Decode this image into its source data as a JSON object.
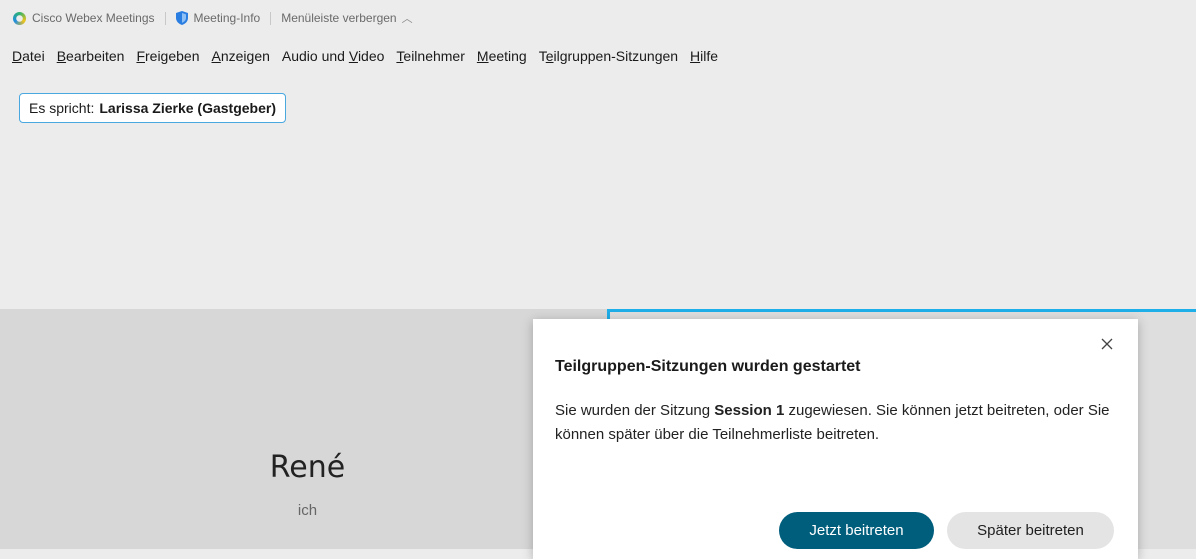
{
  "titlebar": {
    "app_name": "Cisco Webex Meetings",
    "meeting_info": "Meeting-Info",
    "hide_menubar": "Menüleiste verbergen"
  },
  "menu": [
    {
      "underline": "D",
      "rest": "atei"
    },
    {
      "underline": "B",
      "rest": "earbeiten"
    },
    {
      "underline": "F",
      "rest": "reigeben"
    },
    {
      "underline": "A",
      "rest": "nzeigen"
    },
    {
      "pre": "Audio und ",
      "underline": "V",
      "rest": "ideo"
    },
    {
      "underline": "T",
      "rest": "eilnehmer"
    },
    {
      "underline": "M",
      "rest": "eeting"
    },
    {
      "pre": "T",
      "underline": "e",
      "rest": "ilgruppen-Sitzungen"
    },
    {
      "underline": "H",
      "rest": "ilfe"
    }
  ],
  "speaker": {
    "label": "Es spricht:",
    "name": "Larissa Zierke (Gastgeber)"
  },
  "participant": {
    "name": "René",
    "subtitle": "ich"
  },
  "dialog": {
    "title": "Teilgruppen-Sitzungen wurden gestartet",
    "body_prefix": "Sie wurden der Sitzung ",
    "session_name": "Session 1",
    "body_suffix": " zugewiesen. Sie können jetzt beitreten, oder Sie können später über die Teilnehmerliste beitreten.",
    "join_button": "Jetzt beitreten",
    "later_button": "Später beitreten"
  },
  "colors": {
    "accent": "#1eaee8",
    "primary_button": "#005e7d",
    "secondary_button": "#e4e4e4"
  }
}
